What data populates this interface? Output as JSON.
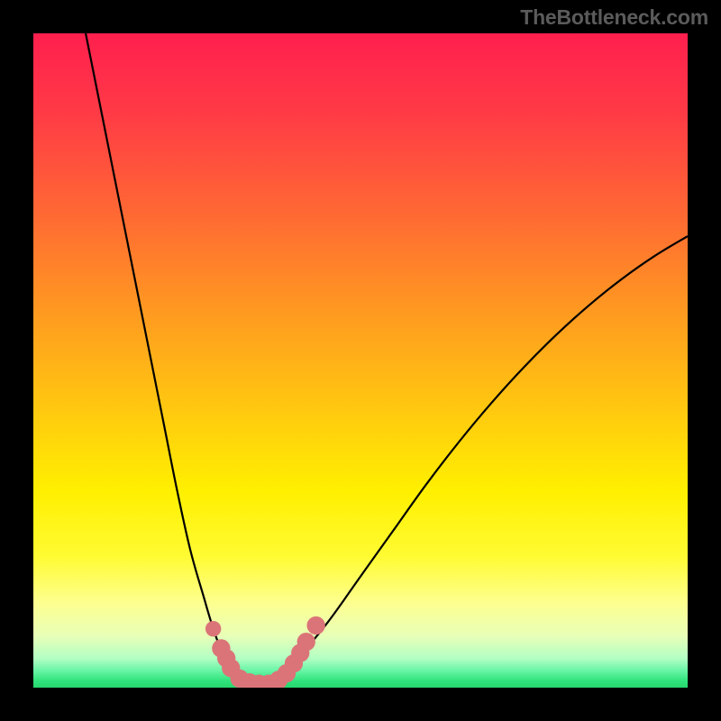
{
  "attribution": "TheBottleneck.com",
  "colors": {
    "curve_stroke": "#000000",
    "marker_fill": "#db7478",
    "green_band": "#2fe37b"
  },
  "chart_data": {
    "type": "line",
    "title": "",
    "xlabel": "",
    "ylabel": "",
    "xlim": [
      0,
      100
    ],
    "ylim": [
      0,
      100
    ],
    "grid": false,
    "legend": false,
    "series": [
      {
        "name": "left-curve",
        "x": [
          8,
          10,
          12,
          14,
          16,
          18,
          20,
          22,
          24,
          26,
          27.5,
          29,
          30.5,
          32
        ],
        "y": [
          100,
          90,
          80,
          70,
          60,
          50,
          40,
          30,
          21,
          14,
          9,
          5,
          2.5,
          1
        ]
      },
      {
        "name": "right-curve",
        "x": [
          37,
          40,
          45,
          50,
          55,
          60,
          65,
          70,
          75,
          80,
          85,
          90,
          95,
          100
        ],
        "y": [
          1,
          4,
          10,
          17,
          24,
          31,
          37.5,
          43.5,
          49,
          54,
          58.5,
          62.5,
          66,
          69
        ]
      },
      {
        "name": "valley-floor",
        "x": [
          32,
          34,
          36,
          37
        ],
        "y": [
          1,
          0.5,
          0.5,
          1
        ]
      }
    ],
    "markers": [
      {
        "x": 27.5,
        "y": 9.0,
        "r": 1.2
      },
      {
        "x": 28.7,
        "y": 6.0,
        "r": 1.4
      },
      {
        "x": 29.5,
        "y": 4.5,
        "r": 1.4
      },
      {
        "x": 30.2,
        "y": 3.0,
        "r": 1.4
      },
      {
        "x": 31.5,
        "y": 1.4,
        "r": 1.4
      },
      {
        "x": 33.0,
        "y": 0.8,
        "r": 1.4
      },
      {
        "x": 34.5,
        "y": 0.6,
        "r": 1.4
      },
      {
        "x": 36.0,
        "y": 0.6,
        "r": 1.4
      },
      {
        "x": 37.5,
        "y": 1.2,
        "r": 1.4
      },
      {
        "x": 38.7,
        "y": 2.2,
        "r": 1.4
      },
      {
        "x": 39.8,
        "y": 3.7,
        "r": 1.4
      },
      {
        "x": 40.8,
        "y": 5.3,
        "r": 1.4
      },
      {
        "x": 41.7,
        "y": 7.0,
        "r": 1.4
      },
      {
        "x": 43.2,
        "y": 9.5,
        "r": 1.4
      }
    ],
    "background_gradient_stops": [
      {
        "offset": 0.0,
        "color": "#ff1f4e"
      },
      {
        "offset": 0.12,
        "color": "#ff3a46"
      },
      {
        "offset": 0.28,
        "color": "#ff6a33"
      },
      {
        "offset": 0.43,
        "color": "#ff9b20"
      },
      {
        "offset": 0.58,
        "color": "#ffca0f"
      },
      {
        "offset": 0.7,
        "color": "#fff000"
      },
      {
        "offset": 0.8,
        "color": "#fffb33"
      },
      {
        "offset": 0.87,
        "color": "#fdff8f"
      },
      {
        "offset": 0.92,
        "color": "#e9ffb7"
      },
      {
        "offset": 0.955,
        "color": "#b4ffc4"
      },
      {
        "offset": 0.975,
        "color": "#64f4a3"
      },
      {
        "offset": 0.99,
        "color": "#2fe37b"
      },
      {
        "offset": 1.0,
        "color": "#28d56d"
      }
    ]
  }
}
